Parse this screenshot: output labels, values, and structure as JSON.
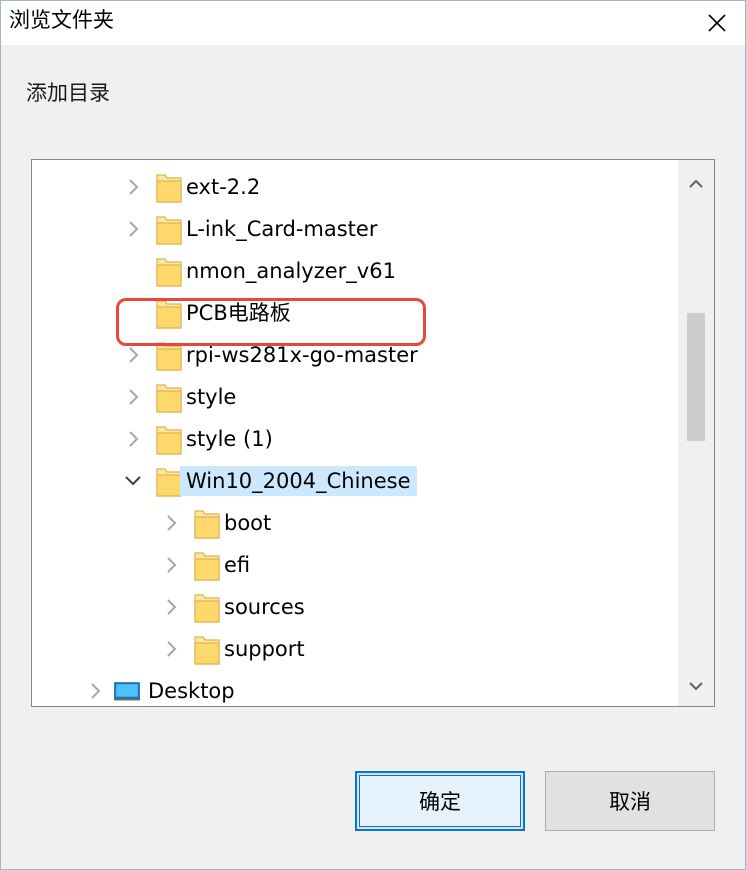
{
  "window": {
    "title": "浏览文件夹",
    "close_icon": "close-icon"
  },
  "instruction": "添加目录",
  "tree": {
    "items": [
      {
        "label": "ext-2.2",
        "expander": "collapsed",
        "icon": "folder-icon"
      },
      {
        "label": "L-ink_Card-master",
        "expander": "collapsed",
        "icon": "folder-icon"
      },
      {
        "label": "nmon_analyzer_v61",
        "expander": "none",
        "icon": "folder-icon"
      },
      {
        "label": "PCB电路板",
        "expander": "none",
        "icon": "folder-icon"
      },
      {
        "label": "rpi-ws281x-go-master",
        "expander": "collapsed",
        "icon": "folder-icon"
      },
      {
        "label": "style",
        "expander": "collapsed",
        "icon": "folder-icon"
      },
      {
        "label": "style (1)",
        "expander": "collapsed",
        "icon": "folder-icon"
      },
      {
        "label": "Win10_2004_Chinese",
        "expander": "expanded",
        "icon": "folder-icon",
        "selected": true
      },
      {
        "label": "boot",
        "expander": "collapsed",
        "icon": "folder-icon"
      },
      {
        "label": "efi",
        "expander": "collapsed",
        "icon": "folder-icon"
      },
      {
        "label": "sources",
        "expander": "collapsed",
        "icon": "folder-icon"
      },
      {
        "label": "support",
        "expander": "collapsed",
        "icon": "folder-icon"
      },
      {
        "label": "Desktop",
        "expander": "collapsed",
        "icon": "desktop-icon"
      }
    ]
  },
  "buttons": {
    "ok_label": "确定",
    "cancel_label": "取消"
  },
  "colors": {
    "selection": "#cce8ff",
    "highlight_border": "#e8473c",
    "accent": "#0078d7",
    "folder": "#ffe08a"
  }
}
